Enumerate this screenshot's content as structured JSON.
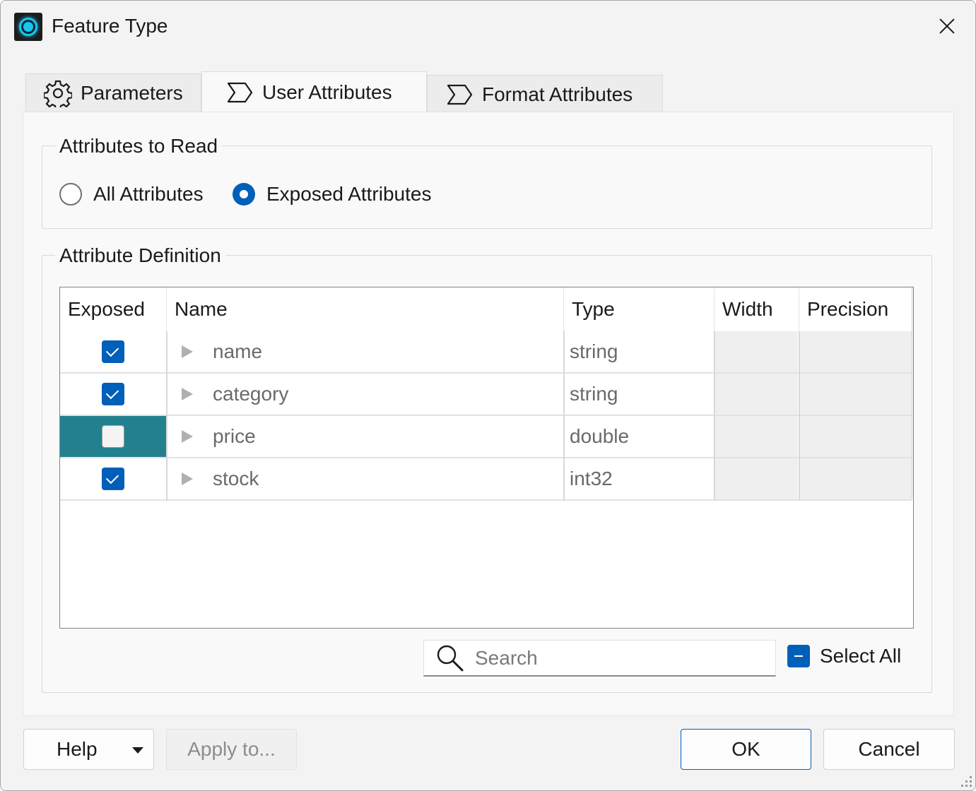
{
  "window": {
    "title": "Feature Type"
  },
  "tabs": [
    {
      "label": "Parameters",
      "icon": "gear-icon"
    },
    {
      "label": "User Attributes",
      "icon": "attribute-icon",
      "active": true
    },
    {
      "label": "Format Attributes",
      "icon": "attribute-icon"
    }
  ],
  "read_group": {
    "title": "Attributes to Read",
    "options": [
      {
        "label": "All Attributes",
        "selected": false
      },
      {
        "label": "Exposed Attributes",
        "selected": true
      }
    ]
  },
  "definition_group": {
    "title": "Attribute Definition",
    "columns": [
      "Exposed",
      "Name",
      "Type",
      "Width",
      "Precision"
    ],
    "rows": [
      {
        "exposed": true,
        "name": "name",
        "type": "string",
        "width": "",
        "precision": ""
      },
      {
        "exposed": true,
        "name": "category",
        "type": "string",
        "width": "",
        "precision": ""
      },
      {
        "exposed": false,
        "name": "price",
        "type": "double",
        "width": "",
        "precision": "",
        "highlighted": true
      },
      {
        "exposed": true,
        "name": "stock",
        "type": "int32",
        "width": "",
        "precision": ""
      }
    ],
    "search": {
      "placeholder": "Search",
      "value": ""
    },
    "select_all": {
      "label": "Select All",
      "state": "partial"
    }
  },
  "footer": {
    "help": "Help",
    "apply": "Apply to...",
    "ok": "OK",
    "cancel": "Cancel"
  },
  "colors": {
    "accent": "#005fb8",
    "highlight_cell": "#23818f"
  }
}
